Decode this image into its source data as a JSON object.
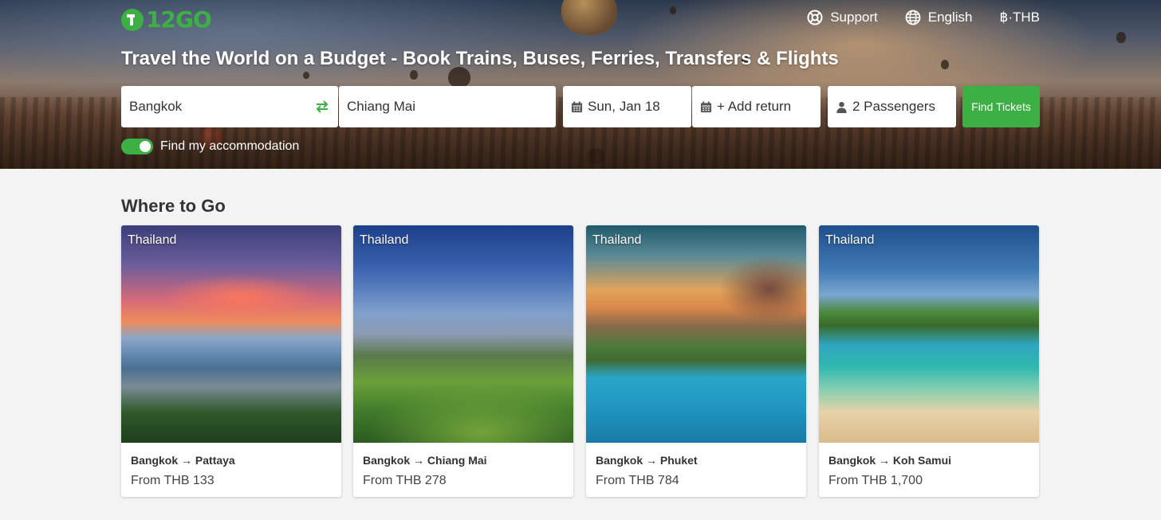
{
  "header": {
    "logo_text": "12GO",
    "nav": {
      "support": "Support",
      "language": "English",
      "currency": "฿·THB"
    },
    "headline": "Travel the World on a Budget - Book Trains, Buses, Ferries, Transfers & Flights"
  },
  "search": {
    "from_value": "Bangkok",
    "to_value": "Chiang Mai",
    "date_value": "Sun, Jan 18",
    "return_value": "+ Add return",
    "passengers_value": "2 Passengers",
    "find_label": "Find Tickets",
    "accommodation_label": "Find my accommodation",
    "accommodation_on": true
  },
  "where_to_go": {
    "title": "Where to Go",
    "cards": [
      {
        "country": "Thailand",
        "route": "Bangkok → Pattaya",
        "price": "From THB 133"
      },
      {
        "country": "Thailand",
        "route": "Bangkok → Chiang Mai",
        "price": "From THB 278"
      },
      {
        "country": "Thailand",
        "route": "Bangkok → Phuket",
        "price": "From THB 784"
      },
      {
        "country": "Thailand",
        "route": "Bangkok → Koh Samui",
        "price": "From THB 1,700"
      }
    ]
  },
  "colors": {
    "brand_green": "#3cb043",
    "page_bg": "#f3f3f3"
  },
  "icons": [
    "support-icon",
    "globe-icon",
    "swap-icon",
    "calendar-icon",
    "person-icon"
  ]
}
